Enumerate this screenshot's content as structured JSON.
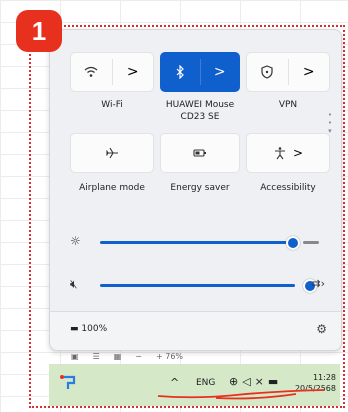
{
  "badge": {
    "number": "1"
  },
  "quick_settings": {
    "tiles": [
      {
        "label": "Wi-Fi",
        "icon": "wifi-icon",
        "glyph": "◔",
        "active": false
      },
      {
        "label": "HUAWEI Mouse CD23 SE",
        "icon": "bluetooth-icon",
        "glyph": "ᛒ",
        "active": true
      },
      {
        "label": "VPN",
        "icon": "shield-icon",
        "glyph": "⛨",
        "active": false
      },
      {
        "label": "Airplane mode",
        "icon": "airplane-icon",
        "glyph": "✈",
        "active": false
      },
      {
        "label": "Energy saver",
        "icon": "energy-saver-icon",
        "glyph": "◑",
        "active": false
      },
      {
        "label": "Accessibility",
        "icon": "accessibility-icon",
        "glyph": "♿",
        "active": false
      }
    ],
    "chevron": ">",
    "brightness": {
      "level": 0.78,
      "icon": "brightness-icon"
    },
    "volume": {
      "level": 0.95,
      "icon": "volume-muted-icon"
    },
    "battery": {
      "text": "100%"
    },
    "accent_color": "#0f5fcc"
  },
  "below_strip": [
    "▣",
    "☰",
    "▦",
    "−",
    "+ 76%"
  ],
  "taskbar": {
    "chevron": "^",
    "language": "ENG",
    "time": "11:28",
    "date": "20/5/2568"
  }
}
